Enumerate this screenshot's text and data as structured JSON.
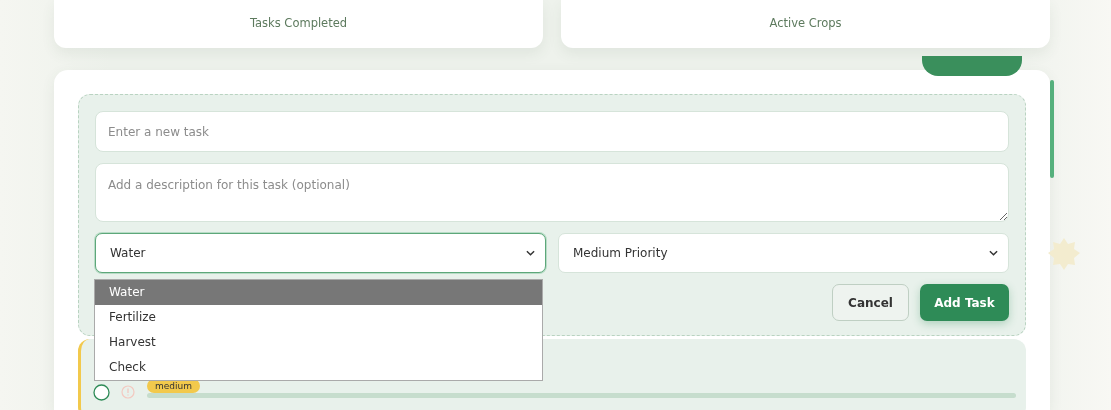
{
  "stats": [
    {
      "label": "Tasks Completed"
    },
    {
      "label": "Active Crops"
    }
  ],
  "form": {
    "title_placeholder": "Enter a new task",
    "description_placeholder": "Add a description for this task (optional)",
    "type_select": {
      "value": "Water",
      "open": true,
      "options": [
        {
          "label": "Water",
          "selected": true
        },
        {
          "label": "Fertilize",
          "selected": false
        },
        {
          "label": "Harvest",
          "selected": false
        },
        {
          "label": "Check",
          "selected": false
        }
      ]
    },
    "priority_select": {
      "value": "Medium Priority"
    },
    "buttons": [
      {
        "label": "Cancel",
        "kind": "secondary"
      },
      {
        "label": "Add Task",
        "kind": "primary"
      }
    ]
  },
  "tasks": [
    {
      "priority": "medium",
      "color": "#f2c94c",
      "done": false
    }
  ]
}
